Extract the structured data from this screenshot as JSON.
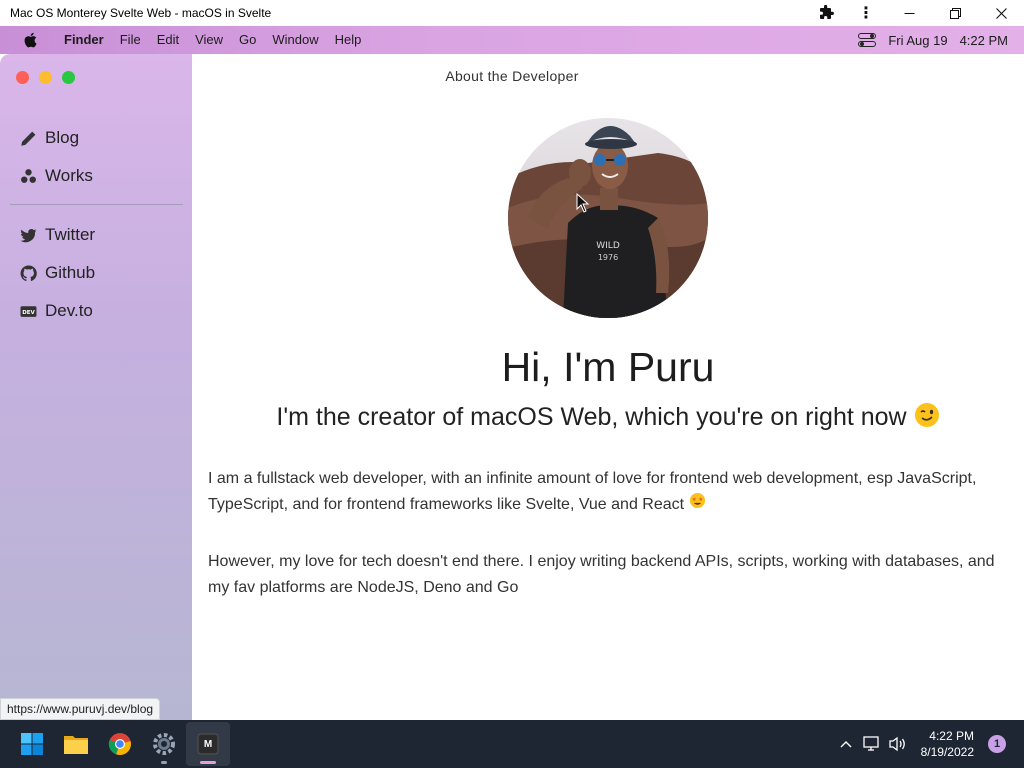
{
  "browser": {
    "title": "Mac OS Monterey Svelte Web - macOS in Svelte",
    "status_url": "https://www.puruvj.dev/blog"
  },
  "menubar": {
    "app_name": "Finder",
    "items": [
      "File",
      "Edit",
      "View",
      "Go",
      "Window",
      "Help"
    ],
    "date": "Fri Aug 19",
    "time": "4:22 PM"
  },
  "sidebar": {
    "items": [
      {
        "label": "Blog",
        "icon": "pencil-icon"
      },
      {
        "label": "Works",
        "icon": "cubes-icon"
      }
    ],
    "links": [
      {
        "label": "Twitter",
        "icon": "twitter-icon"
      },
      {
        "label": "Github",
        "icon": "github-icon"
      },
      {
        "label": "Dev.to",
        "icon": "devto-icon"
      }
    ]
  },
  "main": {
    "title": "About the Developer",
    "heading": "Hi, I'm Puru",
    "tagline": "I'm the creator of macOS Web, which you're on right now",
    "paragraph1": "I am a fullstack web developer, with an infinite amount of love for frontend web development, esp JavaScript, TypeScript, and for frontend frameworks like Svelte, Vue and React",
    "paragraph2": "However, my love for tech doesn't end there. I enjoy writing backend APIs, scripts, working with databases, and my fav platforms are NodeJS, Deno and Go"
  },
  "taskbar": {
    "apps": [
      "windows-start-icon",
      "file-explorer-icon",
      "chrome-icon",
      "settings-icon",
      "macos-web-app-icon"
    ],
    "active_app_label": "M",
    "time": "4:22 PM",
    "date": "8/19/2022",
    "notification_count": "1"
  },
  "colors": {
    "menubar_start": "#c88fd6",
    "menubar_end": "#e3b0e8",
    "traffic_red": "#fe5f57",
    "traffic_yellow": "#febc2e",
    "traffic_green": "#28c840",
    "taskbar_bg": "#1f2633"
  }
}
